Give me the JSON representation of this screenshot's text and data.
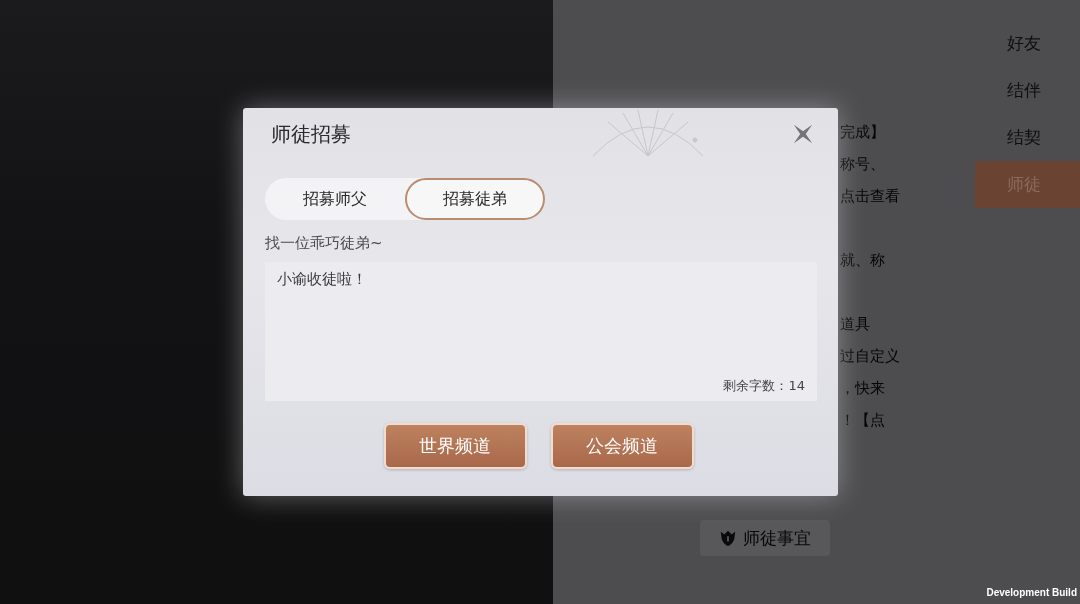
{
  "side_tabs": [
    {
      "label": "好友",
      "selected": false
    },
    {
      "label": "结伴",
      "selected": false
    },
    {
      "label": "结契",
      "selected": false
    },
    {
      "label": "师徒",
      "selected": true
    }
  ],
  "background_text": [
    [
      "完成】",
      "称号、",
      "点击查看"
    ],
    [
      "就、称"
    ],
    [
      "道具",
      "过自定义",
      "，快来",
      "！【点"
    ]
  ],
  "affairs_button": {
    "label": "师徒事宜"
  },
  "build_label": "Development Build",
  "dialog": {
    "title": "师徒招募",
    "tabs": [
      {
        "label": "招募师父",
        "selected": false
      },
      {
        "label": "招募徒弟",
        "selected": true
      }
    ],
    "prompt": "找一位乖巧徒弟~",
    "message": {
      "value": "小谕收徒啦！",
      "counter": "剩余字数：14"
    },
    "buttons": [
      "世界频道",
      "公会频道"
    ]
  }
}
